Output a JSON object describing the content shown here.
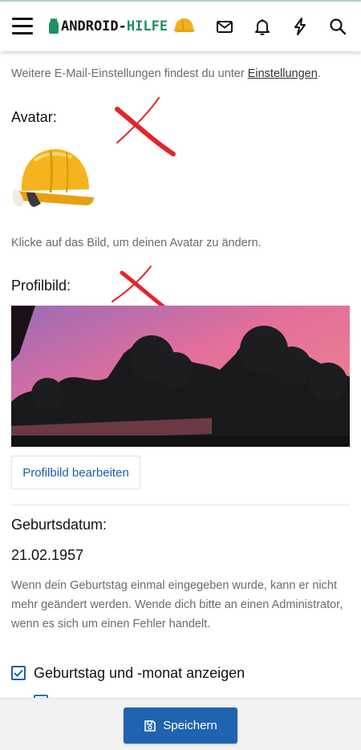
{
  "header": {
    "logo_text_part1": "ANDROID-",
    "logo_text_part2": "HILFE",
    "icons": [
      "menu-icon",
      "avatar-helmet-icon",
      "mail-icon",
      "bell-icon",
      "lightning-icon",
      "search-icon"
    ]
  },
  "email_settings": {
    "text_before": "Weitere E-Mail-Einstellungen findest du unter ",
    "link": "Einstellungen",
    "text_after": "."
  },
  "avatar": {
    "label": "Avatar:",
    "hint": "Klicke auf das Bild, um deinen Avatar zu ändern."
  },
  "profile_image": {
    "label": "Profilbild:",
    "edit_button": "Profilbild bearbeiten"
  },
  "birthday": {
    "label": "Geburtsdatum:",
    "value": "21.02.1957",
    "note": "Wenn dein Geburtstag einmal eingegeben wurde, kann er nicht mehr geändert werden. Wende dich bitte an einen Administrator, wenn es sich um einen Fehler handelt.",
    "show_checkbox_label": "Geburtstag und -monat anzeigen",
    "show_checkbox_checked": true
  },
  "footer": {
    "save_label": "Speichern"
  },
  "colors": {
    "brand_green": "#1f8f63",
    "primary_blue": "#1f63b1",
    "annotation_red": "#e0262b"
  }
}
